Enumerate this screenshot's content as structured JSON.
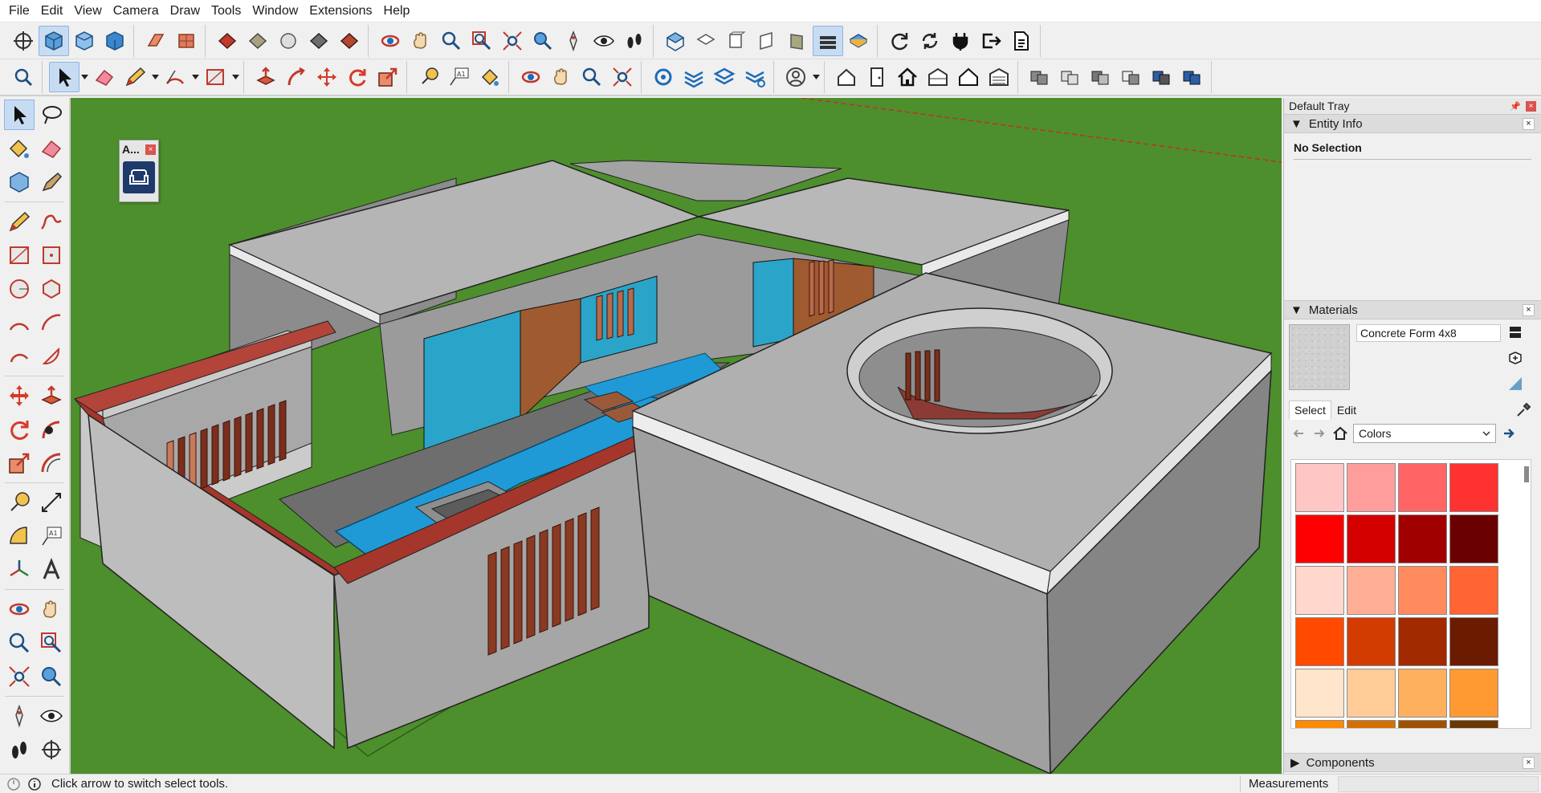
{
  "menu": [
    "File",
    "Edit",
    "View",
    "Camera",
    "Draw",
    "Tools",
    "Window",
    "Extensions",
    "Help"
  ],
  "floating_toolbar": {
    "title": "A...",
    "close": "×"
  },
  "tray": {
    "title": "Default Tray",
    "entity_info": {
      "title": "Entity Info",
      "text": "No Selection"
    },
    "materials": {
      "title": "Materials",
      "material_name": "Concrete Form 4x8",
      "tabs": [
        "Select",
        "Edit"
      ],
      "collection": "Colors",
      "swatches": [
        "#ffc6c6",
        "#ff9d9d",
        "#ff6565",
        "#ff3232",
        "#ff0000",
        "#d40000",
        "#a10000",
        "#6b0000",
        "#ffd7cc",
        "#ffae96",
        "#ff8a5e",
        "#ff6432",
        "#ff4a00",
        "#d23c00",
        "#a12a00",
        "#6b1b00",
        "#ffe5cc",
        "#ffcb96",
        "#ffb05e",
        "#ff9a32",
        "#ff8a00",
        "#d47000",
        "#a05200",
        "#6b3800"
      ]
    },
    "components": {
      "title": "Components"
    }
  },
  "status": {
    "text": "Click arrow to switch select tools.",
    "measurements_label": "Measurements"
  },
  "colors": {
    "grass": "#4d8f2c",
    "accent": "#c7dcf3",
    "roof": "#a9a9a9",
    "wood": "#a4362b",
    "water": "#1f9ad6"
  }
}
